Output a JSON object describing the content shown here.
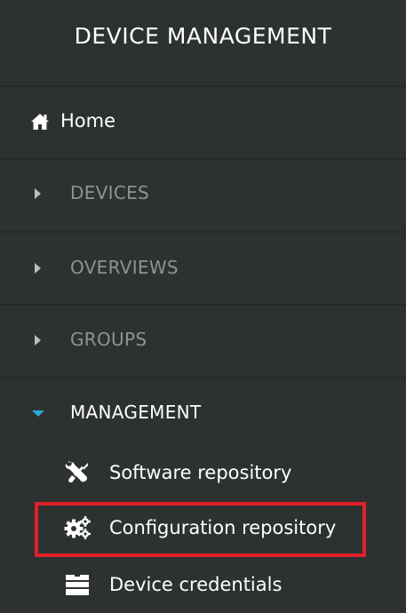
{
  "app": {
    "title": "DEVICE MANAGEMENT"
  },
  "nav": {
    "home": {
      "label": "Home",
      "icon": "home-icon"
    },
    "sections": [
      {
        "label": "DEVICES",
        "expanded": false
      },
      {
        "label": "OVERVIEWS",
        "expanded": false
      },
      {
        "label": "GROUPS",
        "expanded": false
      },
      {
        "label": "MANAGEMENT",
        "expanded": true
      }
    ],
    "management_items": [
      {
        "label": "Software repository",
        "icon": "wrench-screwdriver-icon"
      },
      {
        "label": "Configuration repository",
        "icon": "gears-icon",
        "highlighted": true
      },
      {
        "label": "Device credentials",
        "icon": "credentials-stack-icon"
      }
    ]
  },
  "colors": {
    "sidebar_bg": "#2d3230",
    "divider": "#262a28",
    "text_primary": "#ffffff",
    "text_dim": "#8e9391",
    "caret_active": "#2aa8d8",
    "highlight": "#e0202a"
  }
}
